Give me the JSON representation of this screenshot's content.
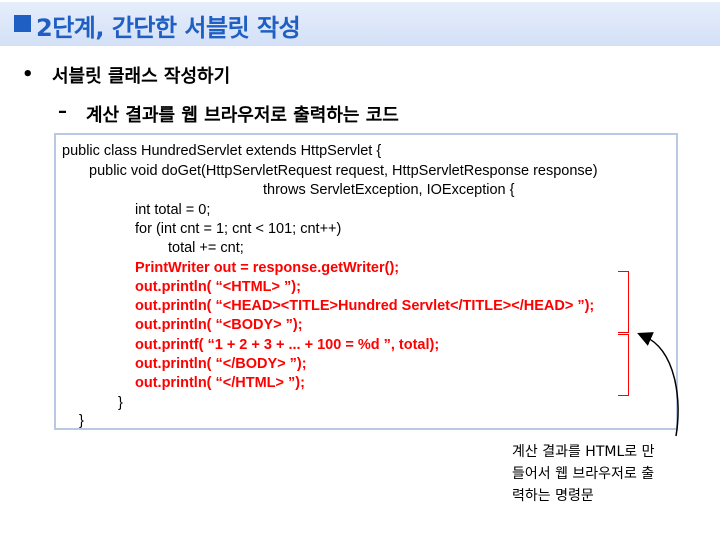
{
  "title": "2단계, 간단한 서블릿 작성",
  "bullet1": {
    "marker": "•",
    "text": "서블릿 클래스 작성하기"
  },
  "bullet2": {
    "marker": "–",
    "text": "계산 결과를 웹 브라우저로 출력하는 코드"
  },
  "code": {
    "lines": [
      {
        "text": "public class HundredServlet extends HttpServlet {",
        "highlight": false
      },
      {
        "text": "public void doGet(HttpServletRequest request, HttpServletResponse response)",
        "highlight": false
      },
      {
        "text": "throws ServletException, IOException {",
        "highlight": false
      },
      {
        "text": "int total = 0;",
        "highlight": false
      },
      {
        "text": "for (int cnt = 1; cnt < 101; cnt++)",
        "highlight": false
      },
      {
        "text": "total += cnt;",
        "highlight": false
      },
      {
        "text": "PrintWriter out = response.getWriter();",
        "highlight": true
      },
      {
        "text": "out.println( “<HTML> ”);",
        "highlight": true
      },
      {
        "text": "out.println( “<HEAD><TITLE>Hundred Servlet</TITLE></HEAD> ”);",
        "highlight": true
      },
      {
        "text": "out.println( “<BODY> ”);",
        "highlight": true
      },
      {
        "text": "out.printf( “1 + 2 + 3 + ... + 100 = %d ”, total);",
        "highlight": true
      },
      {
        "text": "out.println( “</BODY> ”);",
        "highlight": true
      },
      {
        "text": "out.println( “</HTML> ”);",
        "highlight": true
      },
      {
        "text": "}",
        "highlight": false
      },
      {
        "text": "}",
        "highlight": false
      }
    ]
  },
  "annotation": {
    "lines": [
      "계산 결과를 HTML로 만",
      "들어서 웹 브라우저로 출",
      "력하는 명령문"
    ]
  },
  "colors": {
    "title": "#1f5fc4",
    "highlight": "#ff0000",
    "code_border": "#b9c9e4"
  }
}
